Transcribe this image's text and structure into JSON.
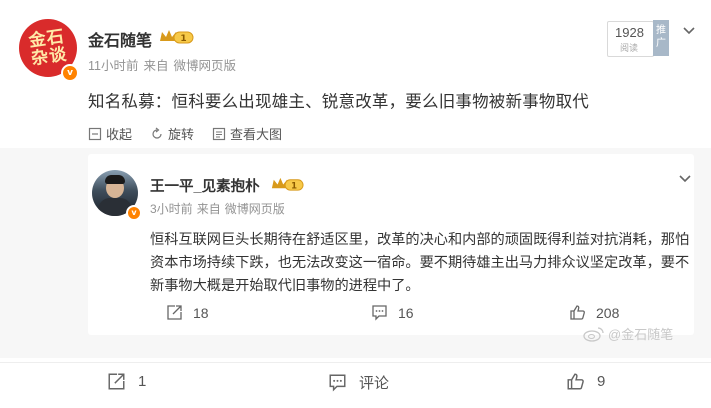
{
  "post": {
    "author": "金石随笔",
    "avatar_text": "金石杂谈",
    "verified_badge": "v",
    "member_badge_level": "1",
    "time": "11小时前",
    "source_prefix": "来自",
    "source": "微博网页版",
    "views_count": "1928",
    "views_label": "阅读",
    "promo_label": "推广",
    "text": "知名私募：恒科要么出现雄主、锐意改革，要么旧事物被新事物取代",
    "mini_actions": {
      "collect": "收起",
      "rotate": "旋转",
      "view_large": "查看大图"
    }
  },
  "repost": {
    "author": "王一平_见素抱朴",
    "verified_badge": "v",
    "member_badge_level": "1",
    "time": "3小时前",
    "source_prefix": "来自",
    "source": "微博网页版",
    "text": "恒科互联网巨头长期待在舒适区里，改革的决心和内部的顽固既得利益对抗消耗，那怕资本市场持续下跌，也无法改变这一宿命。要不期待雄主出马力排众议坚定改革，要不新事物大概是开始取代旧事物的进程中了。",
    "reposts": "18",
    "comments": "16",
    "likes": "208"
  },
  "watermark": "@金石随笔",
  "bottom": {
    "reposts": "1",
    "comments_label": "评论",
    "likes": "9"
  },
  "colors": {
    "accent_orange": "#ff8200",
    "text_main": "#333333",
    "text_meta": "#939393",
    "panel_bg": "#f7f7f7"
  }
}
